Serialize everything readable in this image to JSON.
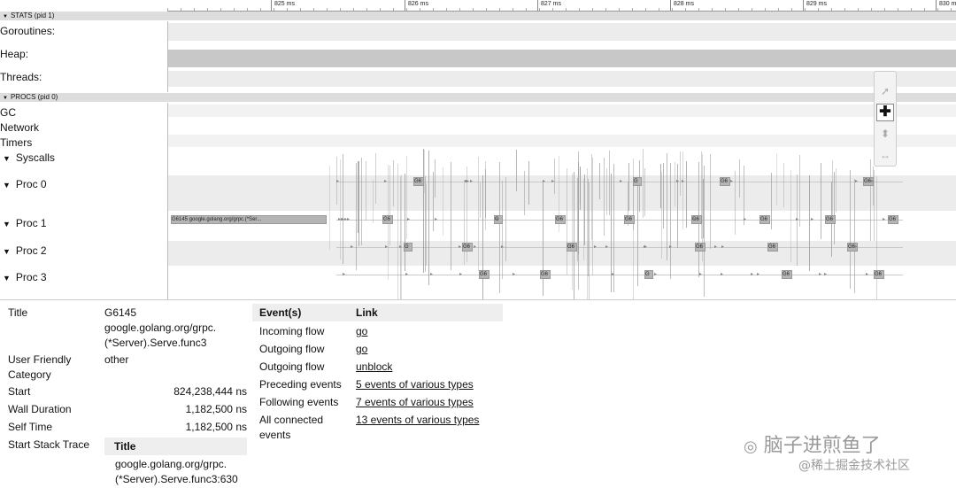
{
  "ruler": {
    "ticks": [
      "825 ms",
      "826 ms",
      "827 ms",
      "828 ms",
      "829 ms",
      "830 ms"
    ]
  },
  "stats": {
    "header": "STATS (pid 1)",
    "rows": [
      "Goroutines:",
      "Heap:",
      "Threads:"
    ]
  },
  "procs": {
    "header": "PROCS (pid 0)",
    "rows": [
      "GC",
      "Network",
      "Timers",
      "Syscalls",
      "Proc 0",
      "Proc 1",
      "Proc 2",
      "Proc 3"
    ],
    "long_slice_label": "G6145 google.golang.org/grpc.(*Ser..."
  },
  "slice_labels": {
    "proc0": [
      "G6",
      "G",
      "G6",
      "G6",
      "G6"
    ],
    "proc1": [
      "G6",
      "G",
      "G6",
      "G6",
      "G6",
      "G6",
      "G6",
      "G6"
    ],
    "proc2": [
      "G",
      "G6",
      "G6",
      "G6",
      "G6",
      "G6",
      "G6"
    ],
    "proc3": [
      "G6",
      "G6",
      "G",
      "G6",
      "G6"
    ]
  },
  "toolbar": {
    "tools": [
      "selection-tool",
      "pan-tool",
      "zoom-tool",
      "timing-tool"
    ]
  },
  "details": {
    "title_key": "Title",
    "title_value": "G6145 google.golang.org/grpc.(*Server).Serve.func3",
    "title_value_lines": [
      "G6145",
      "google.golang.org/grpc.",
      "(*Server).Serve.func3"
    ],
    "category_key_lines": [
      "User Friendly",
      "Category"
    ],
    "category_value": "other",
    "start_key": "Start",
    "start_value": "824,238,444 ns",
    "wall_key": "Wall Duration",
    "wall_value": "1,182,500 ns",
    "self_key": "Self Time",
    "self_value": "1,182,500 ns",
    "stack_key": "Start Stack Trace",
    "stack_header": "Title",
    "stack_value_lines": [
      "google.golang.org/grpc.",
      "(*Server).Serve.func3:630"
    ]
  },
  "events": {
    "col_event": "Event(s)",
    "col_link": "Link",
    "rows": [
      {
        "event": "Incoming flow",
        "link": "go"
      },
      {
        "event": "Outgoing flow",
        "link": "go"
      },
      {
        "event": "Outgoing flow",
        "link": "unblock"
      },
      {
        "event": "Preceding events",
        "link": "5 events of various types"
      },
      {
        "event": "Following events",
        "link": "7 events of various types"
      },
      {
        "event": "All connected events",
        "link": "13 events of various types"
      }
    ],
    "last_event_lines": [
      "All connected",
      "events"
    ]
  },
  "watermark": {
    "line1": "脑子进煎鱼了",
    "line2": "@稀土掘金技术社区"
  }
}
